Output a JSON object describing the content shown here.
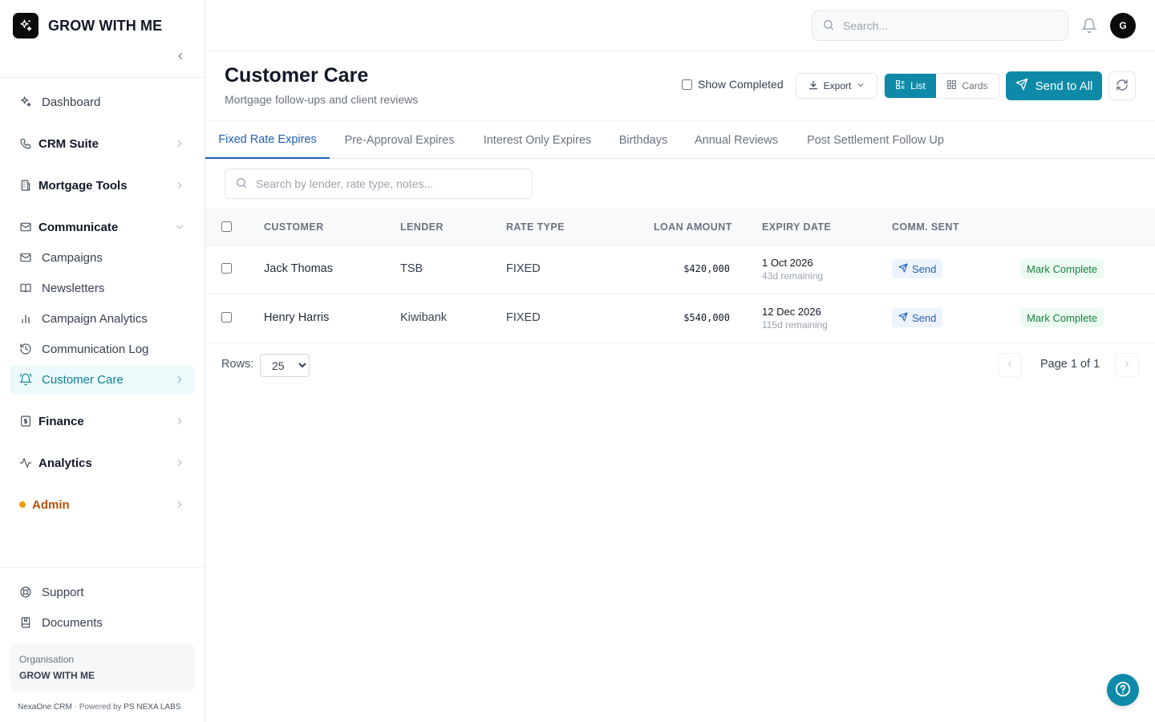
{
  "app": {
    "brand": "GROW WITH ME",
    "accent": "#0e8aa8"
  },
  "sidebar": {
    "items": [
      {
        "label": "Dashboard",
        "icon": "sparkle-icon"
      },
      {
        "label": "CRM Suite",
        "icon": "phone-icon"
      },
      {
        "label": "Mortgage Tools",
        "icon": "building-icon"
      },
      {
        "label": "Communicate",
        "icon": "mail-icon"
      },
      {
        "label": "Campaigns",
        "icon": "mail-icon"
      },
      {
        "label": "Newsletters",
        "icon": "book-icon"
      },
      {
        "label": "Campaign Analytics",
        "icon": "bar-chart-icon"
      },
      {
        "label": "Communication Log",
        "icon": "history-icon"
      },
      {
        "label": "Customer Care",
        "icon": "bell-ring-icon"
      },
      {
        "label": "Finance",
        "icon": "dollar-file-icon"
      },
      {
        "label": "Analytics",
        "icon": "activity-icon"
      },
      {
        "label": "Admin",
        "icon": "dot-icon"
      }
    ],
    "bottom": [
      {
        "label": "Support",
        "icon": "lifebuoy-icon"
      },
      {
        "label": "Documents",
        "icon": "bookmark-book-icon"
      }
    ],
    "org_label": "Organisation",
    "org_name": "GROW WITH ME",
    "footer_product": "NexaOne CRM",
    "footer_sep": " · Powered by ",
    "footer_company": "PS NEXA LABS"
  },
  "header": {
    "search_placeholder": "Search...",
    "avatar_initial": "G"
  },
  "page": {
    "title": "Customer Care",
    "subtitle": "Mortgage follow-ups and client reviews",
    "show_completed": "Show Completed",
    "export_label": "Export",
    "view_list": "List",
    "view_cards": "Cards",
    "send_all": "Send to All"
  },
  "tabs": [
    "Fixed Rate Expires",
    "Pre-Approval Expires",
    "Interest Only Expires",
    "Birthdays",
    "Annual Reviews",
    "Post Settlement Follow Up"
  ],
  "filter": {
    "placeholder": "Search by lender, rate type, notes..."
  },
  "table": {
    "headers": [
      "CUSTOMER",
      "LENDER",
      "RATE TYPE",
      "LOAN AMOUNT",
      "EXPIRY DATE",
      "COMM. SENT"
    ],
    "rows": [
      {
        "customer": "Jack Thomas",
        "lender": "TSB",
        "rate_type": "FIXED",
        "loan_amount": "$420,000",
        "expiry_date": "1 Oct 2026",
        "remaining": "43d remaining",
        "send": "Send",
        "action": "Mark Complete"
      },
      {
        "customer": "Henry Harris",
        "lender": "Kiwibank",
        "rate_type": "FIXED",
        "loan_amount": "$540,000",
        "expiry_date": "12 Dec 2026",
        "remaining": "115d remaining",
        "send": "Send",
        "action": "Mark Complete"
      }
    ]
  },
  "pagination": {
    "rows_label": "Rows:",
    "rows_value": "25",
    "page_text": "Page 1 of 1"
  }
}
